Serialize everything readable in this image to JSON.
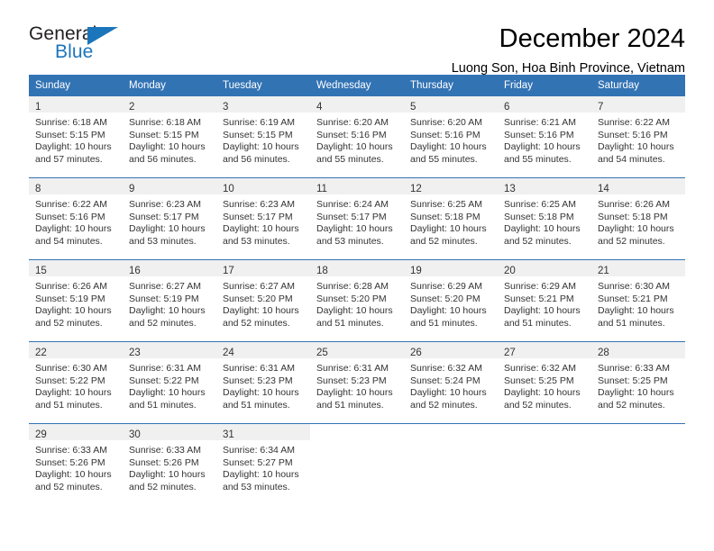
{
  "logo": {
    "word_one": "General",
    "word_two": "Blue",
    "triangle_icon": "triangle-icon",
    "brand_color": "#1b75bb"
  },
  "header": {
    "title": "December 2024",
    "subtitle": "Luong Son, Hoa Binh Province, Vietnam"
  },
  "calendar": {
    "accent_color": "#3273b4",
    "band_color": "#f0f0f0",
    "weekdays": [
      "Sunday",
      "Monday",
      "Tuesday",
      "Wednesday",
      "Thursday",
      "Friday",
      "Saturday"
    ],
    "weeks": [
      [
        {
          "day": "1",
          "sunrise": "Sunrise: 6:18 AM",
          "sunset": "Sunset: 5:15 PM",
          "daylight_1": "Daylight: 10 hours",
          "daylight_2": "and 57 minutes."
        },
        {
          "day": "2",
          "sunrise": "Sunrise: 6:18 AM",
          "sunset": "Sunset: 5:15 PM",
          "daylight_1": "Daylight: 10 hours",
          "daylight_2": "and 56 minutes."
        },
        {
          "day": "3",
          "sunrise": "Sunrise: 6:19 AM",
          "sunset": "Sunset: 5:15 PM",
          "daylight_1": "Daylight: 10 hours",
          "daylight_2": "and 56 minutes."
        },
        {
          "day": "4",
          "sunrise": "Sunrise: 6:20 AM",
          "sunset": "Sunset: 5:16 PM",
          "daylight_1": "Daylight: 10 hours",
          "daylight_2": "and 55 minutes."
        },
        {
          "day": "5",
          "sunrise": "Sunrise: 6:20 AM",
          "sunset": "Sunset: 5:16 PM",
          "daylight_1": "Daylight: 10 hours",
          "daylight_2": "and 55 minutes."
        },
        {
          "day": "6",
          "sunrise": "Sunrise: 6:21 AM",
          "sunset": "Sunset: 5:16 PM",
          "daylight_1": "Daylight: 10 hours",
          "daylight_2": "and 55 minutes."
        },
        {
          "day": "7",
          "sunrise": "Sunrise: 6:22 AM",
          "sunset": "Sunset: 5:16 PM",
          "daylight_1": "Daylight: 10 hours",
          "daylight_2": "and 54 minutes."
        }
      ],
      [
        {
          "day": "8",
          "sunrise": "Sunrise: 6:22 AM",
          "sunset": "Sunset: 5:16 PM",
          "daylight_1": "Daylight: 10 hours",
          "daylight_2": "and 54 minutes."
        },
        {
          "day": "9",
          "sunrise": "Sunrise: 6:23 AM",
          "sunset": "Sunset: 5:17 PM",
          "daylight_1": "Daylight: 10 hours",
          "daylight_2": "and 53 minutes."
        },
        {
          "day": "10",
          "sunrise": "Sunrise: 6:23 AM",
          "sunset": "Sunset: 5:17 PM",
          "daylight_1": "Daylight: 10 hours",
          "daylight_2": "and 53 minutes."
        },
        {
          "day": "11",
          "sunrise": "Sunrise: 6:24 AM",
          "sunset": "Sunset: 5:17 PM",
          "daylight_1": "Daylight: 10 hours",
          "daylight_2": "and 53 minutes."
        },
        {
          "day": "12",
          "sunrise": "Sunrise: 6:25 AM",
          "sunset": "Sunset: 5:18 PM",
          "daylight_1": "Daylight: 10 hours",
          "daylight_2": "and 52 minutes."
        },
        {
          "day": "13",
          "sunrise": "Sunrise: 6:25 AM",
          "sunset": "Sunset: 5:18 PM",
          "daylight_1": "Daylight: 10 hours",
          "daylight_2": "and 52 minutes."
        },
        {
          "day": "14",
          "sunrise": "Sunrise: 6:26 AM",
          "sunset": "Sunset: 5:18 PM",
          "daylight_1": "Daylight: 10 hours",
          "daylight_2": "and 52 minutes."
        }
      ],
      [
        {
          "day": "15",
          "sunrise": "Sunrise: 6:26 AM",
          "sunset": "Sunset: 5:19 PM",
          "daylight_1": "Daylight: 10 hours",
          "daylight_2": "and 52 minutes."
        },
        {
          "day": "16",
          "sunrise": "Sunrise: 6:27 AM",
          "sunset": "Sunset: 5:19 PM",
          "daylight_1": "Daylight: 10 hours",
          "daylight_2": "and 52 minutes."
        },
        {
          "day": "17",
          "sunrise": "Sunrise: 6:27 AM",
          "sunset": "Sunset: 5:20 PM",
          "daylight_1": "Daylight: 10 hours",
          "daylight_2": "and 52 minutes."
        },
        {
          "day": "18",
          "sunrise": "Sunrise: 6:28 AM",
          "sunset": "Sunset: 5:20 PM",
          "daylight_1": "Daylight: 10 hours",
          "daylight_2": "and 51 minutes."
        },
        {
          "day": "19",
          "sunrise": "Sunrise: 6:29 AM",
          "sunset": "Sunset: 5:20 PM",
          "daylight_1": "Daylight: 10 hours",
          "daylight_2": "and 51 minutes."
        },
        {
          "day": "20",
          "sunrise": "Sunrise: 6:29 AM",
          "sunset": "Sunset: 5:21 PM",
          "daylight_1": "Daylight: 10 hours",
          "daylight_2": "and 51 minutes."
        },
        {
          "day": "21",
          "sunrise": "Sunrise: 6:30 AM",
          "sunset": "Sunset: 5:21 PM",
          "daylight_1": "Daylight: 10 hours",
          "daylight_2": "and 51 minutes."
        }
      ],
      [
        {
          "day": "22",
          "sunrise": "Sunrise: 6:30 AM",
          "sunset": "Sunset: 5:22 PM",
          "daylight_1": "Daylight: 10 hours",
          "daylight_2": "and 51 minutes."
        },
        {
          "day": "23",
          "sunrise": "Sunrise: 6:31 AM",
          "sunset": "Sunset: 5:22 PM",
          "daylight_1": "Daylight: 10 hours",
          "daylight_2": "and 51 minutes."
        },
        {
          "day": "24",
          "sunrise": "Sunrise: 6:31 AM",
          "sunset": "Sunset: 5:23 PM",
          "daylight_1": "Daylight: 10 hours",
          "daylight_2": "and 51 minutes."
        },
        {
          "day": "25",
          "sunrise": "Sunrise: 6:31 AM",
          "sunset": "Sunset: 5:23 PM",
          "daylight_1": "Daylight: 10 hours",
          "daylight_2": "and 51 minutes."
        },
        {
          "day": "26",
          "sunrise": "Sunrise: 6:32 AM",
          "sunset": "Sunset: 5:24 PM",
          "daylight_1": "Daylight: 10 hours",
          "daylight_2": "and 52 minutes."
        },
        {
          "day": "27",
          "sunrise": "Sunrise: 6:32 AM",
          "sunset": "Sunset: 5:25 PM",
          "daylight_1": "Daylight: 10 hours",
          "daylight_2": "and 52 minutes."
        },
        {
          "day": "28",
          "sunrise": "Sunrise: 6:33 AM",
          "sunset": "Sunset: 5:25 PM",
          "daylight_1": "Daylight: 10 hours",
          "daylight_2": "and 52 minutes."
        }
      ],
      [
        {
          "day": "29",
          "sunrise": "Sunrise: 6:33 AM",
          "sunset": "Sunset: 5:26 PM",
          "daylight_1": "Daylight: 10 hours",
          "daylight_2": "and 52 minutes."
        },
        {
          "day": "30",
          "sunrise": "Sunrise: 6:33 AM",
          "sunset": "Sunset: 5:26 PM",
          "daylight_1": "Daylight: 10 hours",
          "daylight_2": "and 52 minutes."
        },
        {
          "day": "31",
          "sunrise": "Sunrise: 6:34 AM",
          "sunset": "Sunset: 5:27 PM",
          "daylight_1": "Daylight: 10 hours",
          "daylight_2": "and 53 minutes."
        },
        {
          "day": "",
          "sunrise": "",
          "sunset": "",
          "daylight_1": "",
          "daylight_2": ""
        },
        {
          "day": "",
          "sunrise": "",
          "sunset": "",
          "daylight_1": "",
          "daylight_2": ""
        },
        {
          "day": "",
          "sunrise": "",
          "sunset": "",
          "daylight_1": "",
          "daylight_2": ""
        },
        {
          "day": "",
          "sunrise": "",
          "sunset": "",
          "daylight_1": "",
          "daylight_2": ""
        }
      ]
    ]
  }
}
